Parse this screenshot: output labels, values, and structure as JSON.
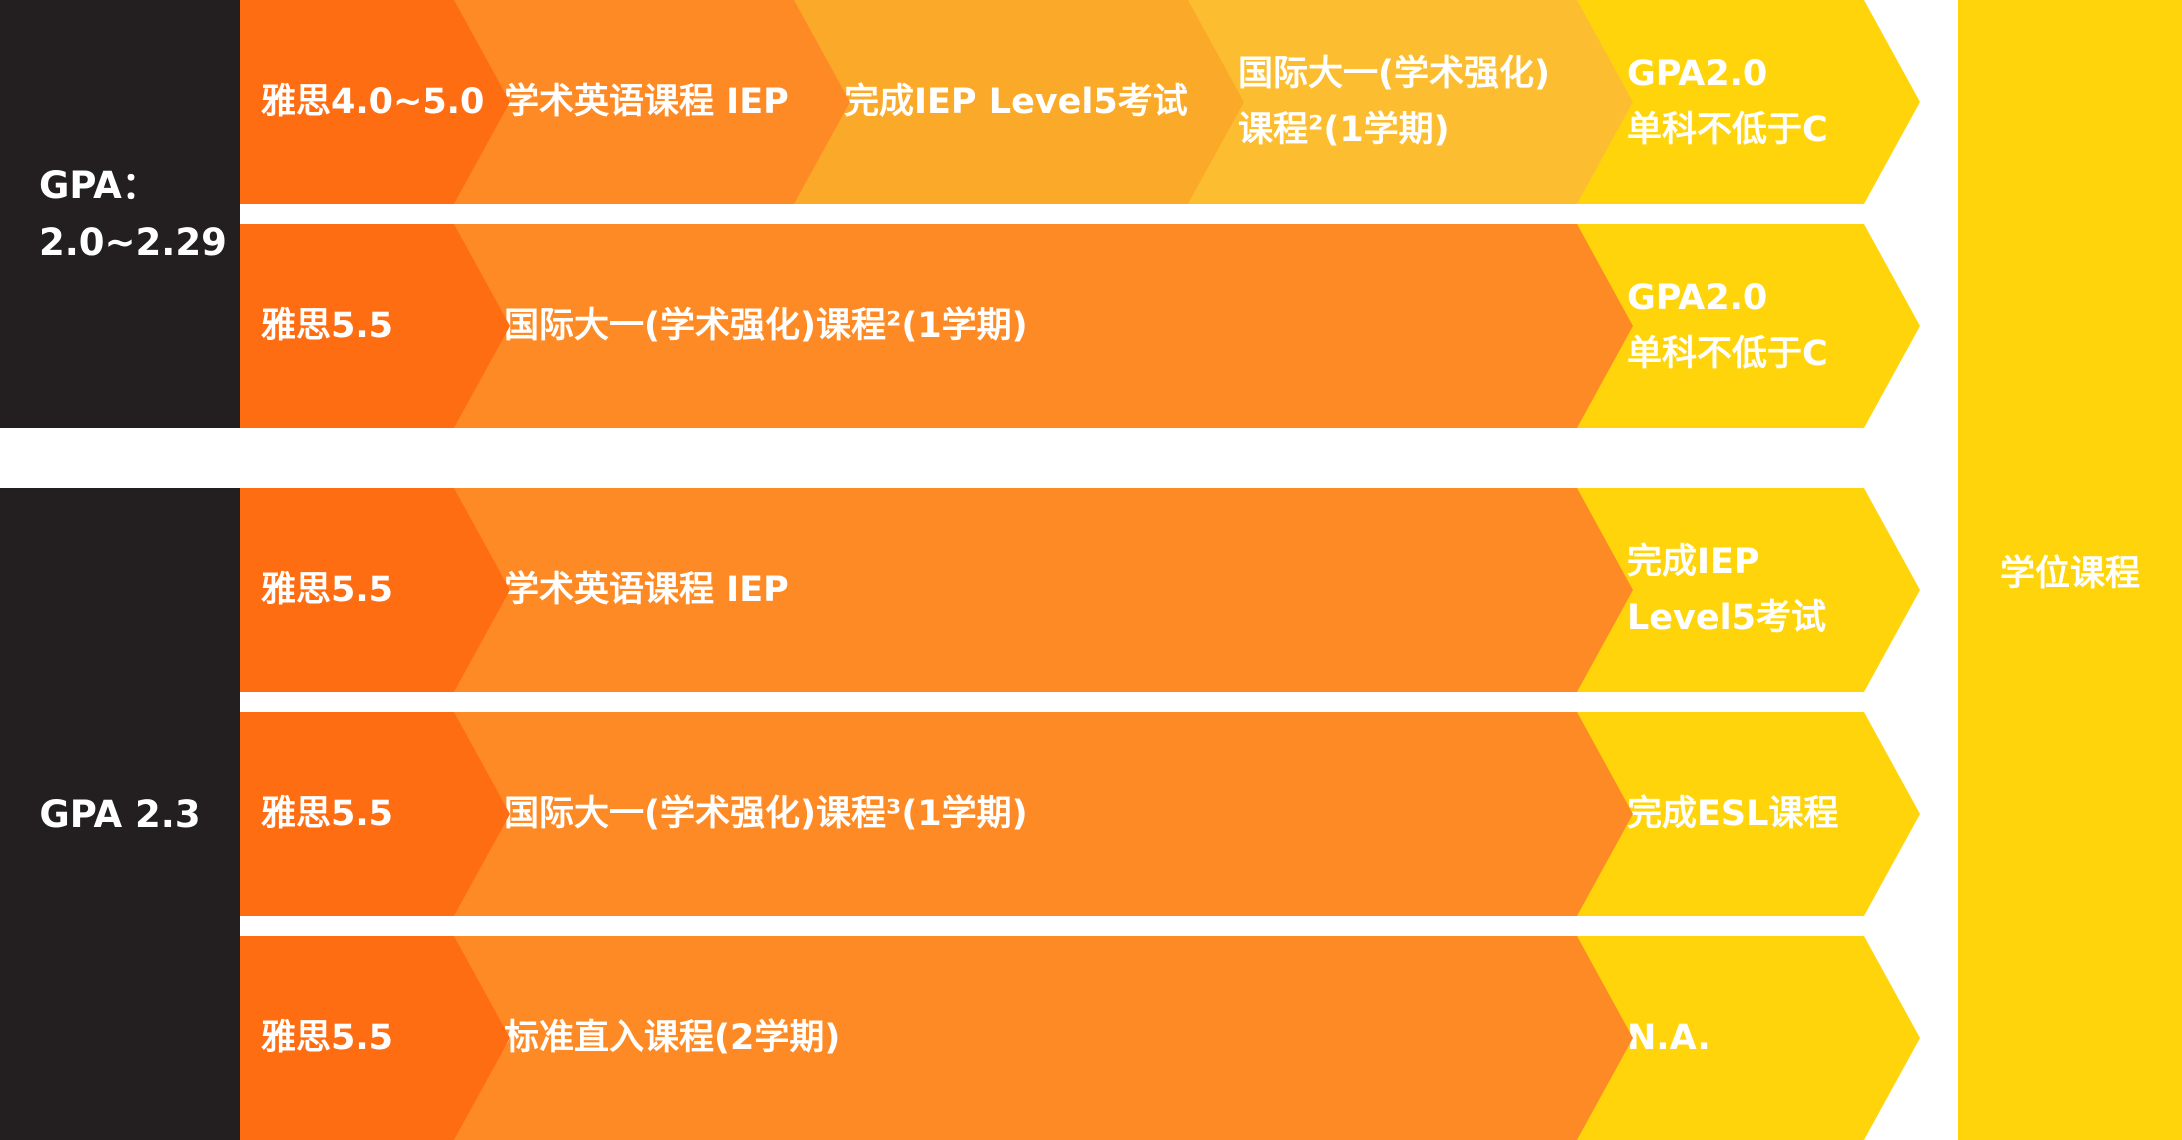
{
  "colors": {
    "dark": "#231f20",
    "orange_dark": "#ff6d13",
    "orange": "#fe8a26",
    "orange_light": "#fba928",
    "amber": "#fcbe30",
    "yellow": "#ffd40b"
  },
  "groups": [
    {
      "gpa_lines": [
        "GPA：",
        "2.0~2.29"
      ],
      "rows": [
        {
          "segments": [
            {
              "lines": [
                "雅思4.0~5.0"
              ]
            },
            {
              "lines": [
                "学术英语课程 IEP"
              ]
            },
            {
              "lines": [
                "完成IEP Level5考试"
              ]
            },
            {
              "lines": [
                "国际大一(学术强化)",
                "课程²(1学期)"
              ]
            },
            {
              "lines": [
                "GPA2.0",
                "单科不低于C"
              ]
            }
          ]
        },
        {
          "segments": [
            {
              "lines": [
                "雅思5.5"
              ]
            },
            {
              "lines": [
                "国际大一(学术强化)课程²(1学期)"
              ]
            },
            {
              "lines": [
                "GPA2.0",
                "单科不低于C"
              ]
            }
          ]
        }
      ]
    },
    {
      "gpa_lines": [
        "GPA 2.3"
      ],
      "rows": [
        {
          "segments": [
            {
              "lines": [
                "雅思5.5"
              ]
            },
            {
              "lines": [
                "学术英语课程 IEP"
              ]
            },
            {
              "lines": [
                "完成IEP",
                "Level5考试"
              ]
            }
          ]
        },
        {
          "segments": [
            {
              "lines": [
                "雅思5.5"
              ]
            },
            {
              "lines": [
                "国际大一(学术强化)课程³(1学期)"
              ]
            },
            {
              "lines": [
                "完成ESL课程"
              ]
            }
          ]
        },
        {
          "segments": [
            {
              "lines": [
                "雅思5.5"
              ]
            },
            {
              "lines": [
                "标准直入课程(2学期)"
              ]
            },
            {
              "lines": [
                "N.A."
              ]
            }
          ]
        }
      ]
    }
  ],
  "destination": {
    "label": "学位课程"
  }
}
